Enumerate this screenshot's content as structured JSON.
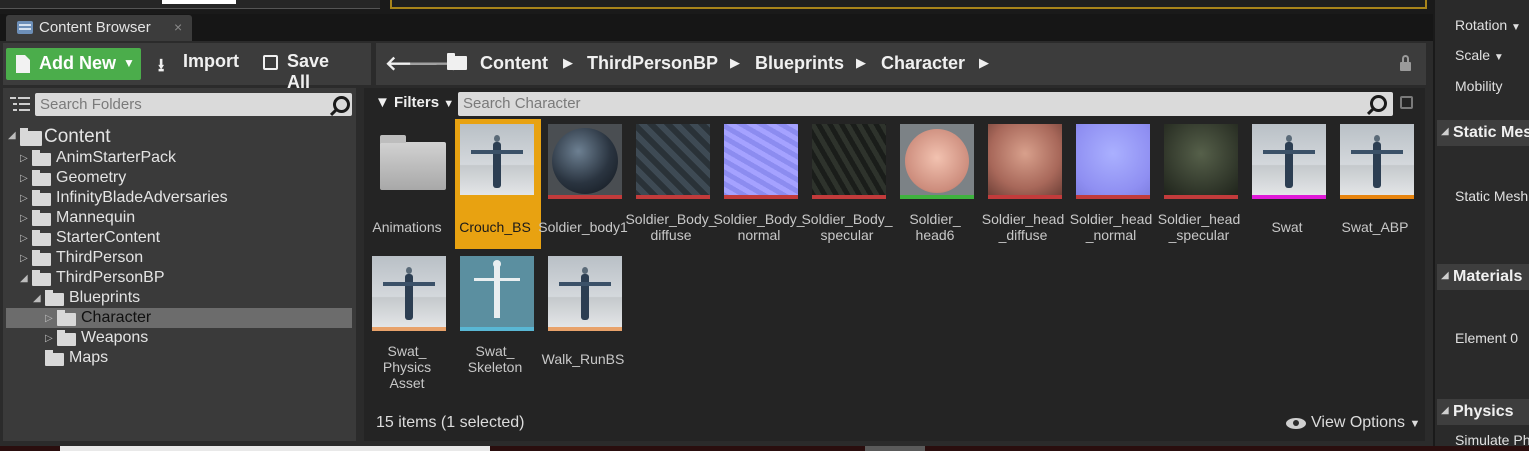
{
  "tab": {
    "title": "Content Browser",
    "close": "×"
  },
  "toolbar": {
    "add_new": "Add New",
    "import": "Import",
    "save_all": "Save All"
  },
  "breadcrumb": [
    "Content",
    "ThirdPersonBP",
    "Blueprints",
    "Character"
  ],
  "folders": {
    "search_placeholder": "Search Folders",
    "tree": [
      {
        "label": "Content",
        "expanded": true
      },
      {
        "label": "AnimStarterPack"
      },
      {
        "label": "Geometry"
      },
      {
        "label": "InfinityBladeAdversaries"
      },
      {
        "label": "Mannequin"
      },
      {
        "label": "StarterContent"
      },
      {
        "label": "ThirdPerson"
      },
      {
        "label": "ThirdPersonBP",
        "expanded": true
      },
      {
        "label": "Blueprints",
        "expanded": true
      },
      {
        "label": "Character",
        "selected": true
      },
      {
        "label": "Weapons"
      },
      {
        "label": "Maps"
      }
    ]
  },
  "assets": {
    "filters_label": "Filters",
    "search_placeholder": "Search Character",
    "items": [
      {
        "name": "Animations",
        "kind": "folder",
        "stripe": ""
      },
      {
        "name": "Crouch_BS",
        "kind": "blendspace",
        "stripe": "#e8a211",
        "selected": true
      },
      {
        "name": "Soldier_body1",
        "kind": "mesh-ball",
        "stripe": "#c23b3b"
      },
      {
        "name": "Soldier_Body_ diffuse",
        "kind": "tex-dark",
        "stripe": "#c23b3b"
      },
      {
        "name": "Soldier_Body_ normal",
        "kind": "tex-norm",
        "stripe": "#c23b3b"
      },
      {
        "name": "Soldier_Body_ specular",
        "kind": "tex-spec",
        "stripe": "#c23b3b"
      },
      {
        "name": "Soldier_ head6",
        "kind": "head",
        "stripe": "#3fb23f"
      },
      {
        "name": "Soldier_head _diffuse",
        "kind": "tex-skin",
        "stripe": "#c23b3b"
      },
      {
        "name": "Soldier_head _normal",
        "kind": "tex-normhead",
        "stripe": "#c23b3b"
      },
      {
        "name": "Soldier_head _specular",
        "kind": "tex-spechead",
        "stripe": "#c23b3b"
      },
      {
        "name": "Swat",
        "kind": "blendspace",
        "stripe": "#e019d8"
      },
      {
        "name": "Swat_ABP",
        "kind": "blendspace",
        "stripe": "#e8850f"
      },
      {
        "name": "Swat_ Physics Asset",
        "kind": "blendspace",
        "stripe": "#e8a26a"
      },
      {
        "name": "Swat_ Skeleton",
        "kind": "skeleton",
        "stripe": "#59b7d4"
      },
      {
        "name": "Walk_RunBS",
        "kind": "blendspace",
        "stripe": "#e8a26a"
      }
    ],
    "status": "15 items (1 selected)",
    "view_options": "View Options"
  },
  "details": {
    "rotation": "Rotation",
    "scale": "Scale",
    "mobility": "Mobility",
    "static_mesh_section": "Static Mes",
    "static_mesh_label": "Static Mesh",
    "materials_section": "Materials",
    "element0": "Element 0",
    "physics_section": "Physics",
    "simulate": "Simulate Ph"
  }
}
